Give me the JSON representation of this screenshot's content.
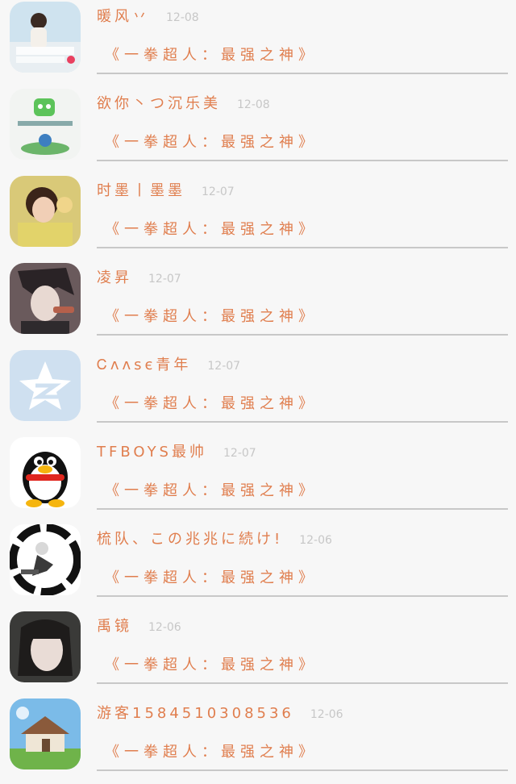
{
  "messages": [
    {
      "name": "暖风丷",
      "date": "12-08",
      "text": "《一拳超人：最强之神》"
    },
    {
      "name": "欲你丶つ沉乐美",
      "date": "12-08",
      "text": "《一拳超人：最强之神》"
    },
    {
      "name": "时墨丨墨墨",
      "date": "12-07",
      "text": "《一拳超人：最强之神》"
    },
    {
      "name": "凌昇",
      "date": "12-07",
      "text": "《一拳超人：最强之神》"
    },
    {
      "name": "Ꮯʌʌsє青年",
      "date": "12-07",
      "text": "《一拳超人：最强之神》"
    },
    {
      "name": "TFBOYS最帅",
      "date": "12-07",
      "text": "《一拳超人：最强之神》"
    },
    {
      "name": "梳队、この兆兆に続け!",
      "date": "12-06",
      "text": "《一拳超人：最强之神》"
    },
    {
      "name": "禹镜",
      "date": "12-06",
      "text": "《一拳超人：最强之神》"
    },
    {
      "name": "游客1584510308536",
      "date": "12-06",
      "text": "《一拳超人：最强之神》"
    }
  ],
  "avatars": [
    "girl-photo-avatar",
    "wechat-banner-avatar",
    "child-photo-avatar",
    "anime-boy-avatar",
    "qzone-star-avatar",
    "qq-penguin-avatar",
    "anime-circle-avatar",
    "woman-portrait-avatar",
    "house-landscape-avatar"
  ],
  "colors": {
    "accent": "#e07e4e",
    "date": "#c7c7c7",
    "divider": "#c8c8c8",
    "background": "#f7f7f7"
  }
}
